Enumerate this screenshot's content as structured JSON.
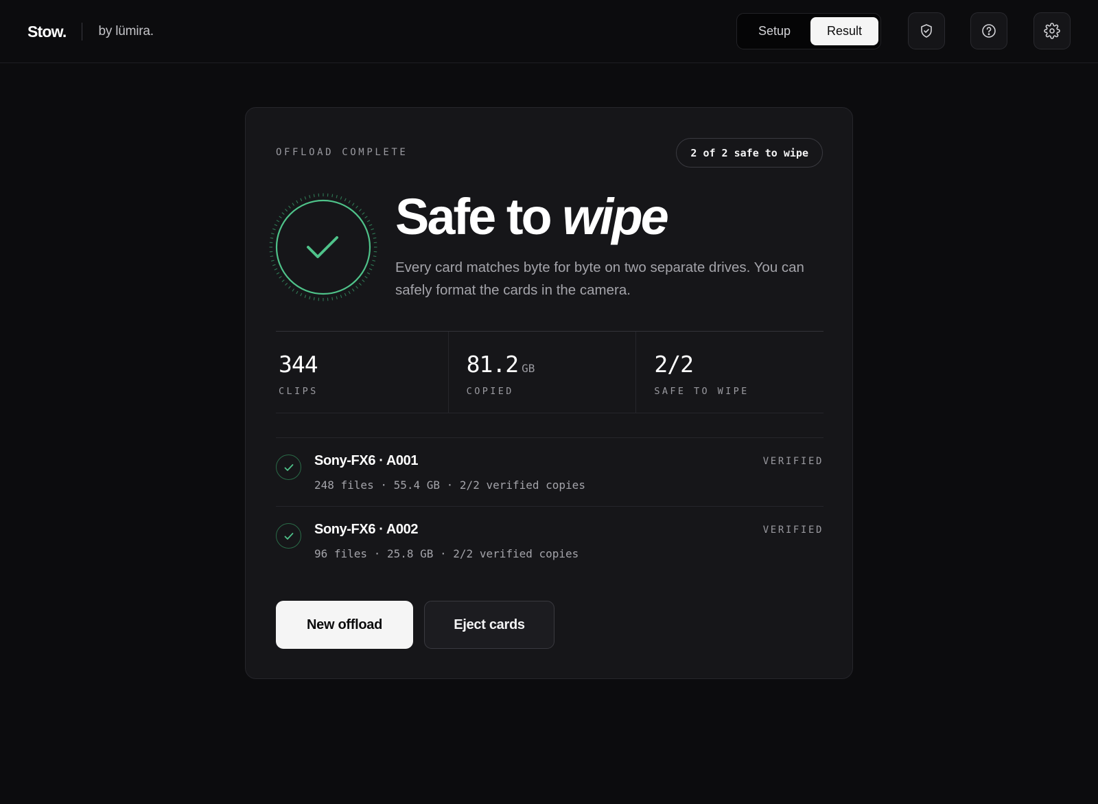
{
  "header": {
    "logo": "Stow.",
    "byline": "by lümira.",
    "tabs": [
      {
        "label": "Setup",
        "active": false
      },
      {
        "label": "Result",
        "active": true
      }
    ],
    "icon_buttons": [
      "shield-check-icon",
      "help-circle-icon",
      "gear-icon"
    ]
  },
  "result": {
    "eyebrow": "OFFLOAD COMPLETE",
    "badge": "2 of 2 safe to wipe",
    "headline_main": "Safe to ",
    "headline_emphasis": "wipe",
    "description": "Every card matches byte for byte on two separate drives. You can safely format the cards in the camera.",
    "accent_color": "#4fc38a",
    "stats": [
      {
        "value": "344",
        "unit": "",
        "label": "CLIPS"
      },
      {
        "value": "81.2",
        "unit": "GB",
        "label": "COPIED"
      },
      {
        "value": "2/2",
        "unit": "",
        "label": "SAFE TO WIPE"
      }
    ],
    "cards": [
      {
        "name": "Sony-FX6 · A001",
        "meta": "248 files · 55.4 GB · 2/2 verified copies",
        "status": "VERIFIED"
      },
      {
        "name": "Sony-FX6 · A002",
        "meta": "96 files · 25.8 GB · 2/2 verified copies",
        "status": "VERIFIED"
      }
    ],
    "actions": {
      "primary": "New offload",
      "secondary": "Eject cards"
    }
  }
}
